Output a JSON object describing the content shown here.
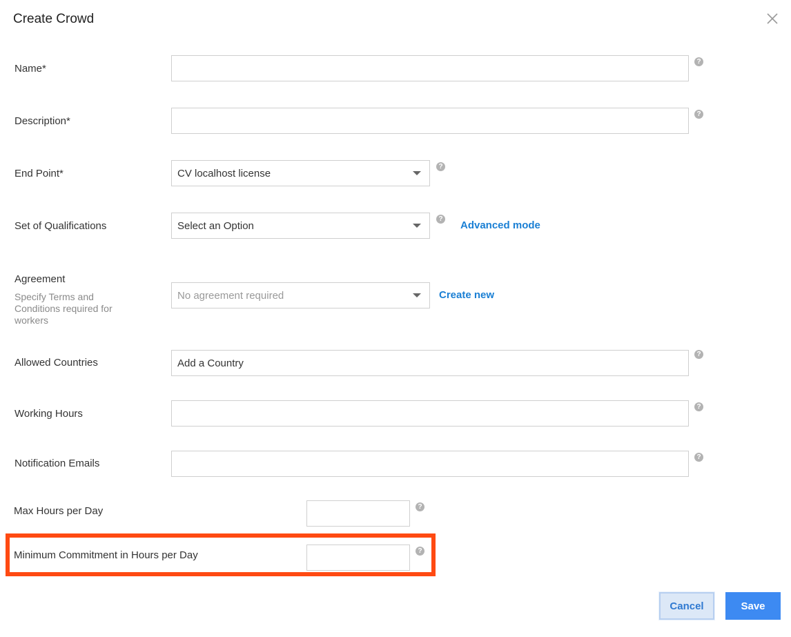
{
  "dialog": {
    "title": "Create Crowd"
  },
  "form": {
    "name": {
      "label": "Name*",
      "value": ""
    },
    "description": {
      "label": "Description*",
      "value": ""
    },
    "end_point": {
      "label": "End Point*",
      "selected": "CV localhost license"
    },
    "qualifications": {
      "label": "Set of Qualifications",
      "selected": "Select an Option",
      "advanced_link": "Advanced mode"
    },
    "agreement": {
      "label": "Agreement",
      "sublabel": "Specify Terms and Conditions required for workers",
      "selected": "No agreement required",
      "create_link": "Create new"
    },
    "countries": {
      "label": "Allowed Countries",
      "placeholder": "Add a Country"
    },
    "working_hours": {
      "label": "Working Hours",
      "value": ""
    },
    "emails": {
      "label": "Notification Emails",
      "value": ""
    },
    "max_hours": {
      "label": "Max Hours per Day",
      "value": ""
    },
    "min_commitment": {
      "label": "Minimum Commitment in Hours per Day",
      "value": ""
    },
    "help_glyph": "?"
  },
  "actions": {
    "cancel": "Cancel",
    "save": "Save"
  },
  "colors": {
    "link": "#1a7fd4",
    "primary": "#3d8af2",
    "highlight": "#ff4a12"
  }
}
